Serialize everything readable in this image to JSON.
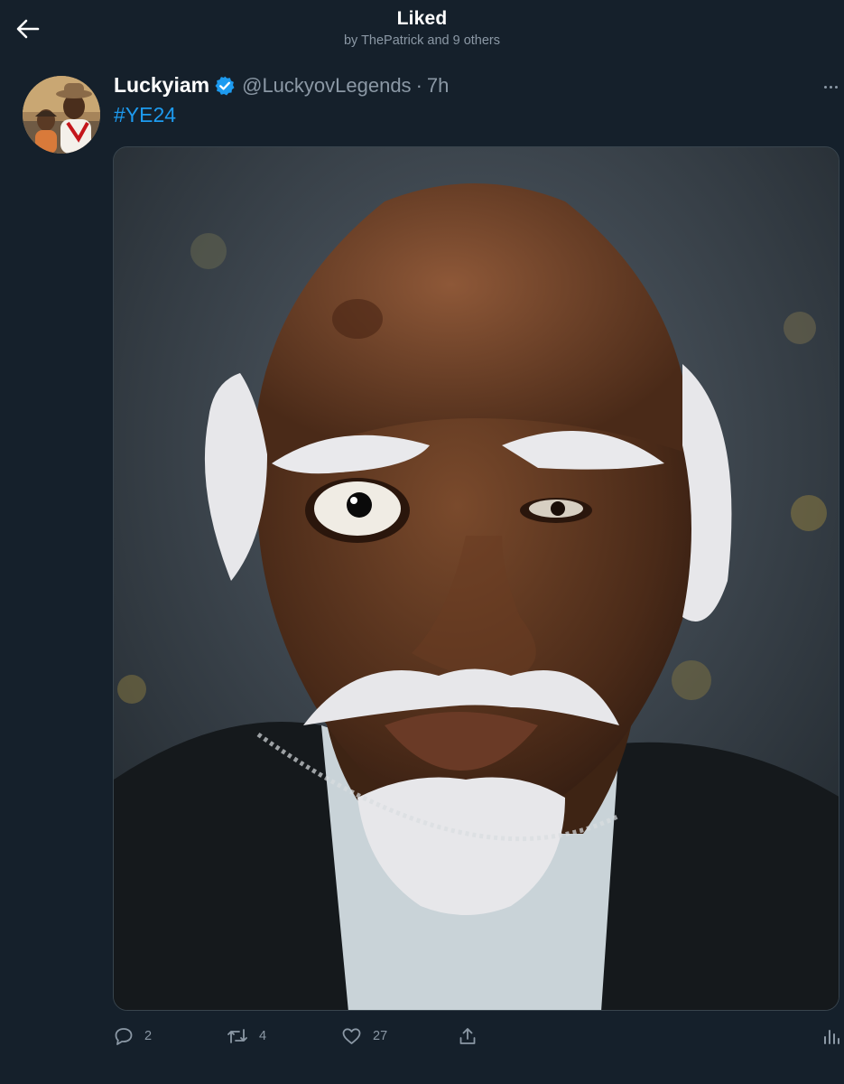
{
  "header": {
    "title": "Liked",
    "subtitle": "by ThePatrick and 9 others"
  },
  "tweet": {
    "display_name": "Luckyiam",
    "handle": "@LuckyovLegends",
    "separator": "·",
    "time": "7h",
    "hashtag": "#YE24",
    "icons": {
      "back": "arrow-left-icon",
      "verified": "verified-badge-icon",
      "more": "more-dots-icon",
      "reply": "reply-icon",
      "retweet": "retweet-icon",
      "like": "heart-icon",
      "share": "share-icon",
      "analytics": "analytics-icon"
    },
    "actions": {
      "replies": "2",
      "retweets": "4",
      "likes": "27"
    }
  },
  "colors": {
    "background": "#15202b",
    "accent": "#1d9bf0",
    "secondary_text": "#8b98a5"
  }
}
